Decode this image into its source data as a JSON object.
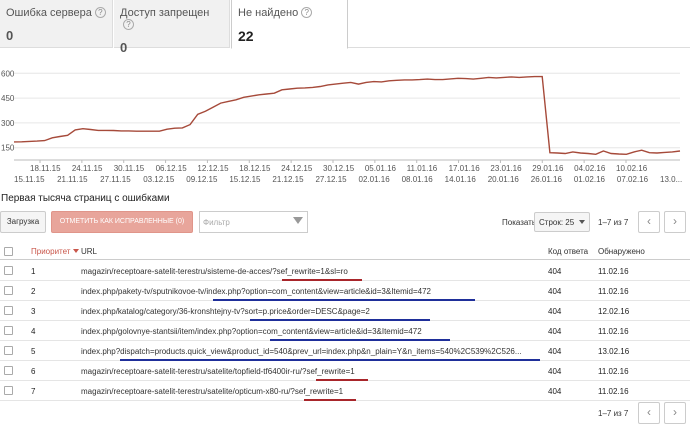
{
  "tabs": [
    {
      "label": "Ошибка сервера",
      "count": "0"
    },
    {
      "label": "Доступ запрещен",
      "count": "0"
    },
    {
      "label": "Не найдено",
      "count": "22"
    }
  ],
  "chart_data": {
    "type": "line",
    "y_ticks": [
      "600",
      "450",
      "300",
      "150"
    ],
    "ylim": [
      100,
      620
    ],
    "x_tick_labels_top": [
      "18.11.15",
      "24.11.15",
      "30.11.15",
      "06.12.15",
      "12.12.15",
      "18.12.15",
      "24.12.15",
      "30.12.15",
      "05.01.16",
      "11.01.16",
      "17.01.16",
      "23.01.16",
      "29.01.16",
      "04.02.16",
      "10.02.16"
    ],
    "x_tick_labels_bottom": [
      "15.11.15",
      "21.11.15",
      "27.11.15",
      "03.12.15",
      "09.12.15",
      "15.12.15",
      "21.12.15",
      "27.12.15",
      "02.01.16",
      "08.01.16",
      "14.01.16",
      "20.01.16",
      "26.01.16",
      "01.02.16",
      "07.02.16",
      "13.0..."
    ],
    "series": [
      {
        "color": "#a64a3a",
        "values": [
          185,
          186,
          188,
          190,
          193,
          210,
          218,
          225,
          258,
          265,
          260,
          255,
          255,
          254,
          252,
          252,
          250,
          250,
          250,
          250,
          262,
          268,
          270,
          290,
          352,
          370,
          395,
          420,
          430,
          440,
          455,
          462,
          470,
          475,
          480,
          500,
          505,
          510,
          512,
          515,
          520,
          530,
          535,
          540,
          545,
          535,
          545,
          550,
          548,
          555,
          558,
          560,
          560,
          562,
          565,
          562,
          562,
          566,
          570,
          568,
          565,
          570,
          575,
          572,
          575,
          578,
          575,
          578,
          580,
          580,
          120,
          118,
          115,
          125,
          118,
          115,
          110,
          130,
          115,
          112,
          110,
          125,
          135,
          120,
          118,
          122,
          125,
          130
        ]
      }
    ]
  },
  "section_title": "Первая тысяча страниц с ошибками",
  "toolbar": {
    "load_label": "Загрузка",
    "mark_fixed_label": "ОТМЕТИТЬ КАК ИСПРАВЛЕННЫЕ (0)",
    "filter_placeholder": "Фильтр",
    "show_label": "Показать",
    "rows_value": "Строк: 25",
    "pager_text": "1–7 из 7"
  },
  "table": {
    "headers": {
      "priority": "Приоритет",
      "url": "URL",
      "code": "Код ответа",
      "date": "Обнаружено"
    },
    "rows": [
      {
        "priority": "1",
        "url": "magazin/receptoare-satelit-terestru/sisteme-de-acces/?sef_rewrite=1&sl=ro",
        "code": "404",
        "date": "11.02.16"
      },
      {
        "priority": "2",
        "url": "index.php/pakety-tv/sputnikovoe-tv/index.php?option=com_content&view=article&id=3&Itemid=472",
        "code": "404",
        "date": "11.02.16"
      },
      {
        "priority": "3",
        "url": "index.php/katalog/category/36-kronshtejny-tv?sort=p.price&order=DESC&page=2",
        "code": "404",
        "date": "12.02.16"
      },
      {
        "priority": "4",
        "url": "index.php/golovnye-stantsii/item/index.php?option=com_content&view=article&id=3&Itemid=472",
        "code": "404",
        "date": "11.02.16"
      },
      {
        "priority": "5",
        "url": "index.php?dispatch=products.quick_view&product_id=540&prev_url=index.php&n_plain=Y&n_items=540%2C539%2C526...",
        "code": "404",
        "date": "13.02.16"
      },
      {
        "priority": "6",
        "url": "magazin/receptoare-satelit-terestru/satelite/topfield-tf6400ir-ru/?sef_rewrite=1",
        "code": "404",
        "date": "11.02.16"
      },
      {
        "priority": "7",
        "url": "magazin/receptoare-satelit-terestru/satelite/opticum-x80-ru/?sef_rewrite=1",
        "code": "404",
        "date": "11.02.16"
      }
    ]
  },
  "bottom_pager": {
    "text": "1–7 из 7"
  },
  "colors": {
    "chart_line": "#a64a3a",
    "accent_red": "#c9564a",
    "underline_red": "#a8262b",
    "underline_blue": "#1f2f9a",
    "button_disabled": "#e8a59b"
  }
}
